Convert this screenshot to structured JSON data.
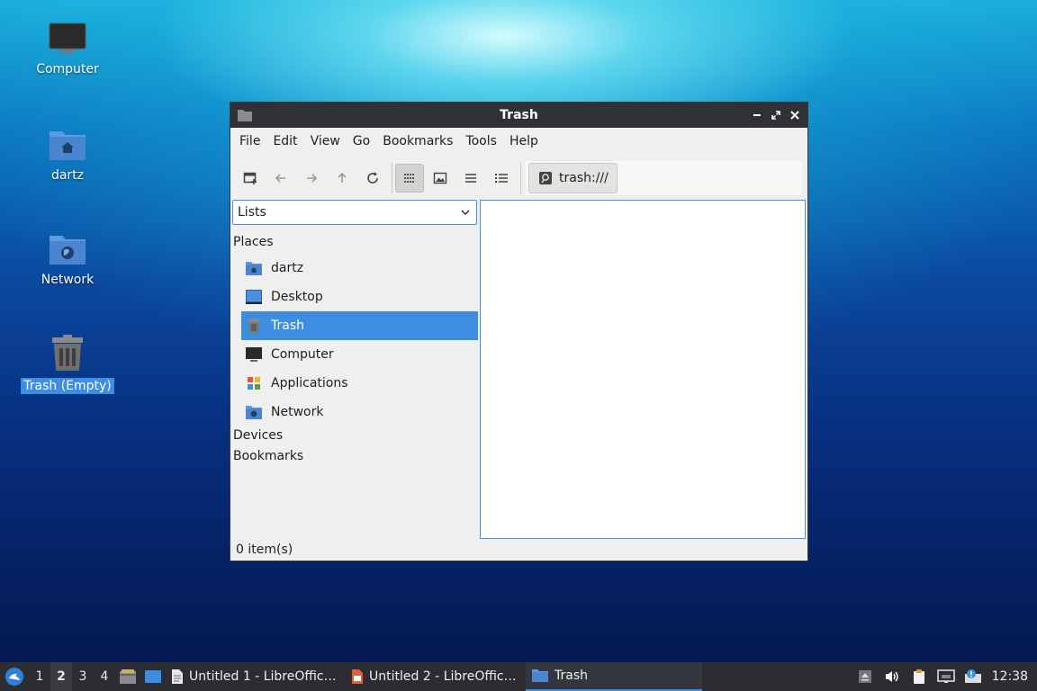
{
  "desktop": {
    "icons": [
      {
        "label": "Computer"
      },
      {
        "label": "dartz"
      },
      {
        "label": "Network"
      },
      {
        "label": "Trash (Empty)"
      }
    ]
  },
  "window": {
    "title": "Trash",
    "menu": [
      "File",
      "Edit",
      "View",
      "Go",
      "Bookmarks",
      "Tools",
      "Help"
    ],
    "location": "trash:///",
    "sidebar": {
      "select_value": "Lists",
      "places_header": "Places",
      "places": [
        {
          "label": "dartz"
        },
        {
          "label": "Desktop"
        },
        {
          "label": "Trash"
        },
        {
          "label": "Computer"
        },
        {
          "label": "Applications"
        },
        {
          "label": "Network"
        }
      ],
      "devices_header": "Devices",
      "bookmarks_header": "Bookmarks"
    },
    "status": "0 item(s)"
  },
  "taskbar": {
    "workspaces": [
      "1",
      "2",
      "3",
      "4"
    ],
    "tasks": [
      {
        "label": "Untitled 1 - LibreOffic…"
      },
      {
        "label": "Untitled 2 - LibreOffic…"
      },
      {
        "label": "Trash"
      }
    ],
    "clock": "12:38"
  },
  "colors": {
    "selection": "#3d8ee0",
    "titlebar": "#2f3136",
    "taskbar": "#2b2d32"
  }
}
